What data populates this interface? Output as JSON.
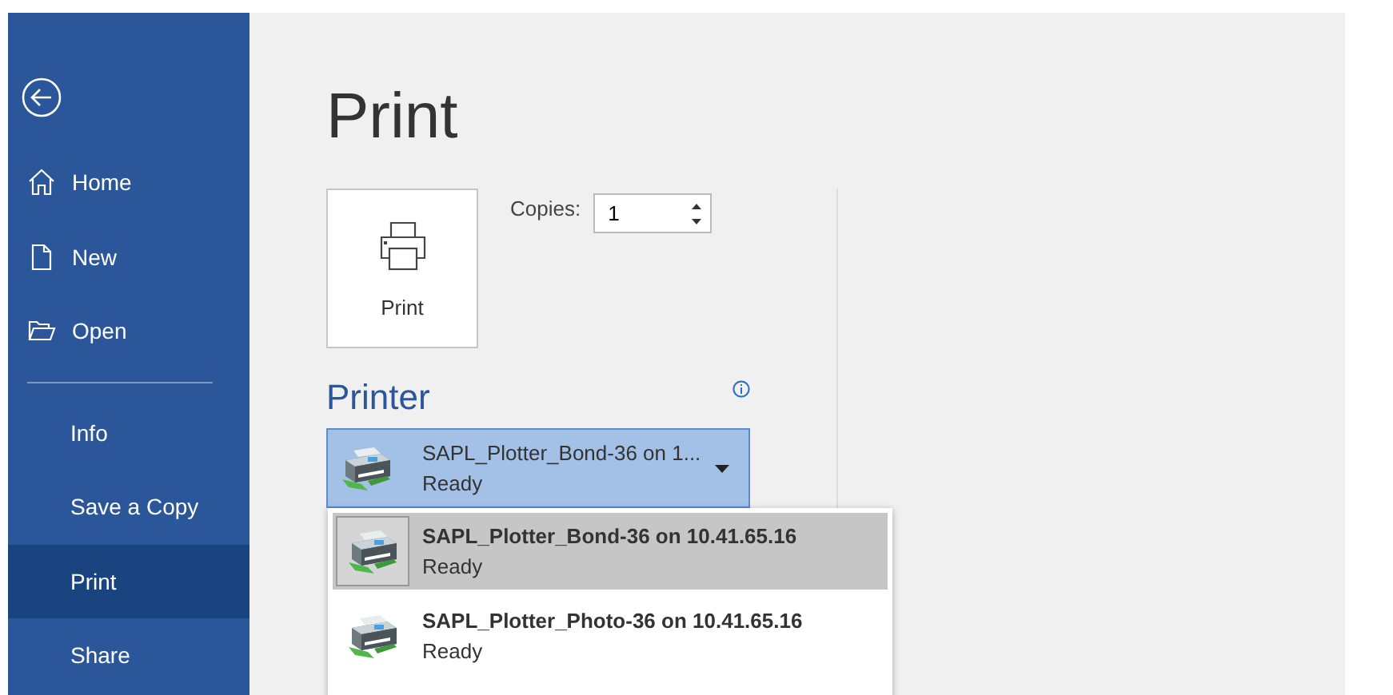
{
  "sidebar": {
    "top_items": [
      {
        "label": "Home",
        "selected": false
      },
      {
        "label": "New",
        "selected": false
      },
      {
        "label": "Open",
        "selected": false
      }
    ],
    "bottom_items": [
      {
        "label": "Info",
        "selected": false
      },
      {
        "label": "Save a Copy",
        "selected": false
      },
      {
        "label": "Print",
        "selected": true
      },
      {
        "label": "Share",
        "selected": false
      }
    ]
  },
  "page_title": "Print",
  "print_button": {
    "label": "Print"
  },
  "copies": {
    "label": "Copies:",
    "value": "1"
  },
  "printer": {
    "heading": "Printer",
    "selected_name": "SAPL_Plotter_Bond-36 on 1...",
    "selected_status": "Ready",
    "expanded": true,
    "options": [
      {
        "name": "SAPL_Plotter_Bond-36 on 10.41.65.16",
        "status": "Ready",
        "selected": true
      },
      {
        "name": "SAPL_Plotter_Photo-36 on 10.41.65.16",
        "status": "Ready",
        "selected": false
      }
    ]
  }
}
